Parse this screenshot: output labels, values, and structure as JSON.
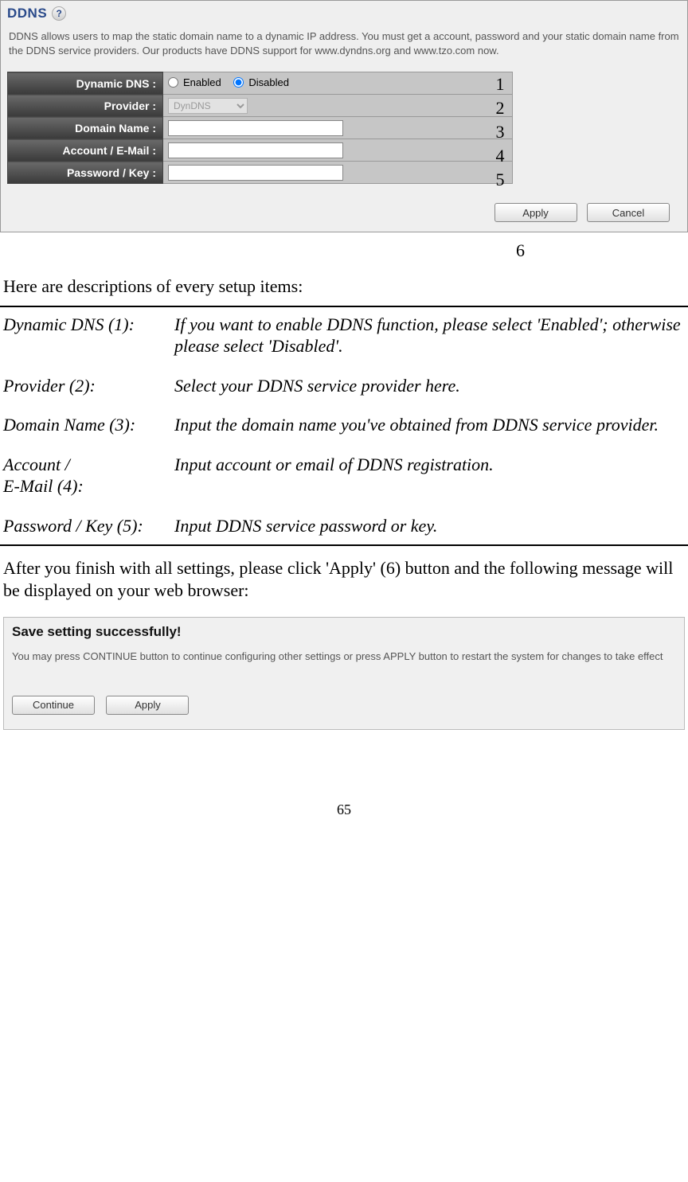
{
  "panel": {
    "title": "DDNS",
    "help_icon": "?",
    "intro": "DDNS allows users to map the static domain name to a dynamic IP address. You must get a account, password and your static domain name from the DDNS service providers. Our products have DDNS support for www.dyndns.org and www.tzo.com now."
  },
  "form": {
    "rows": [
      {
        "label": "Dynamic DNS :",
        "annot": "1"
      },
      {
        "label": "Provider :",
        "annot": "2"
      },
      {
        "label": "Domain Name :",
        "annot": "3"
      },
      {
        "label": "Account / E-Mail :",
        "annot": "4"
      },
      {
        "label": "Password / Key :",
        "annot": "5"
      }
    ],
    "radio": {
      "enabled": "Enabled",
      "disabled": "Disabled"
    },
    "provider_option": "DynDNS"
  },
  "buttons": {
    "apply": "Apply",
    "cancel": "Cancel"
  },
  "annot6": "6",
  "intro_line": "Here are descriptions of every setup items:",
  "descriptions": [
    {
      "label": "Dynamic DNS (1):",
      "text": "If you want to enable DDNS function, please select 'Enabled'; otherwise please select 'Disabled'."
    },
    {
      "label": "Provider (2):",
      "text": "Select your DDNS service provider here."
    },
    {
      "label": "Domain Name (3):",
      "text": "Input the domain name you've obtained from DDNS service provider."
    },
    {
      "label": "Account /\nE-Mail (4):",
      "text": "Input account or email of DDNS registration."
    },
    {
      "label": "Password / Key (5):",
      "text": "Input DDNS service password or key."
    }
  ],
  "after_text": "After you finish with all settings, please click 'Apply' (6) button and the following message will be displayed on your web browser:",
  "save": {
    "title": "Save setting successfully!",
    "text": "You may press CONTINUE button to continue configuring other settings or press APPLY button to restart the system for changes to take effect",
    "continue": "Continue",
    "apply": "Apply"
  },
  "page_number": "65"
}
